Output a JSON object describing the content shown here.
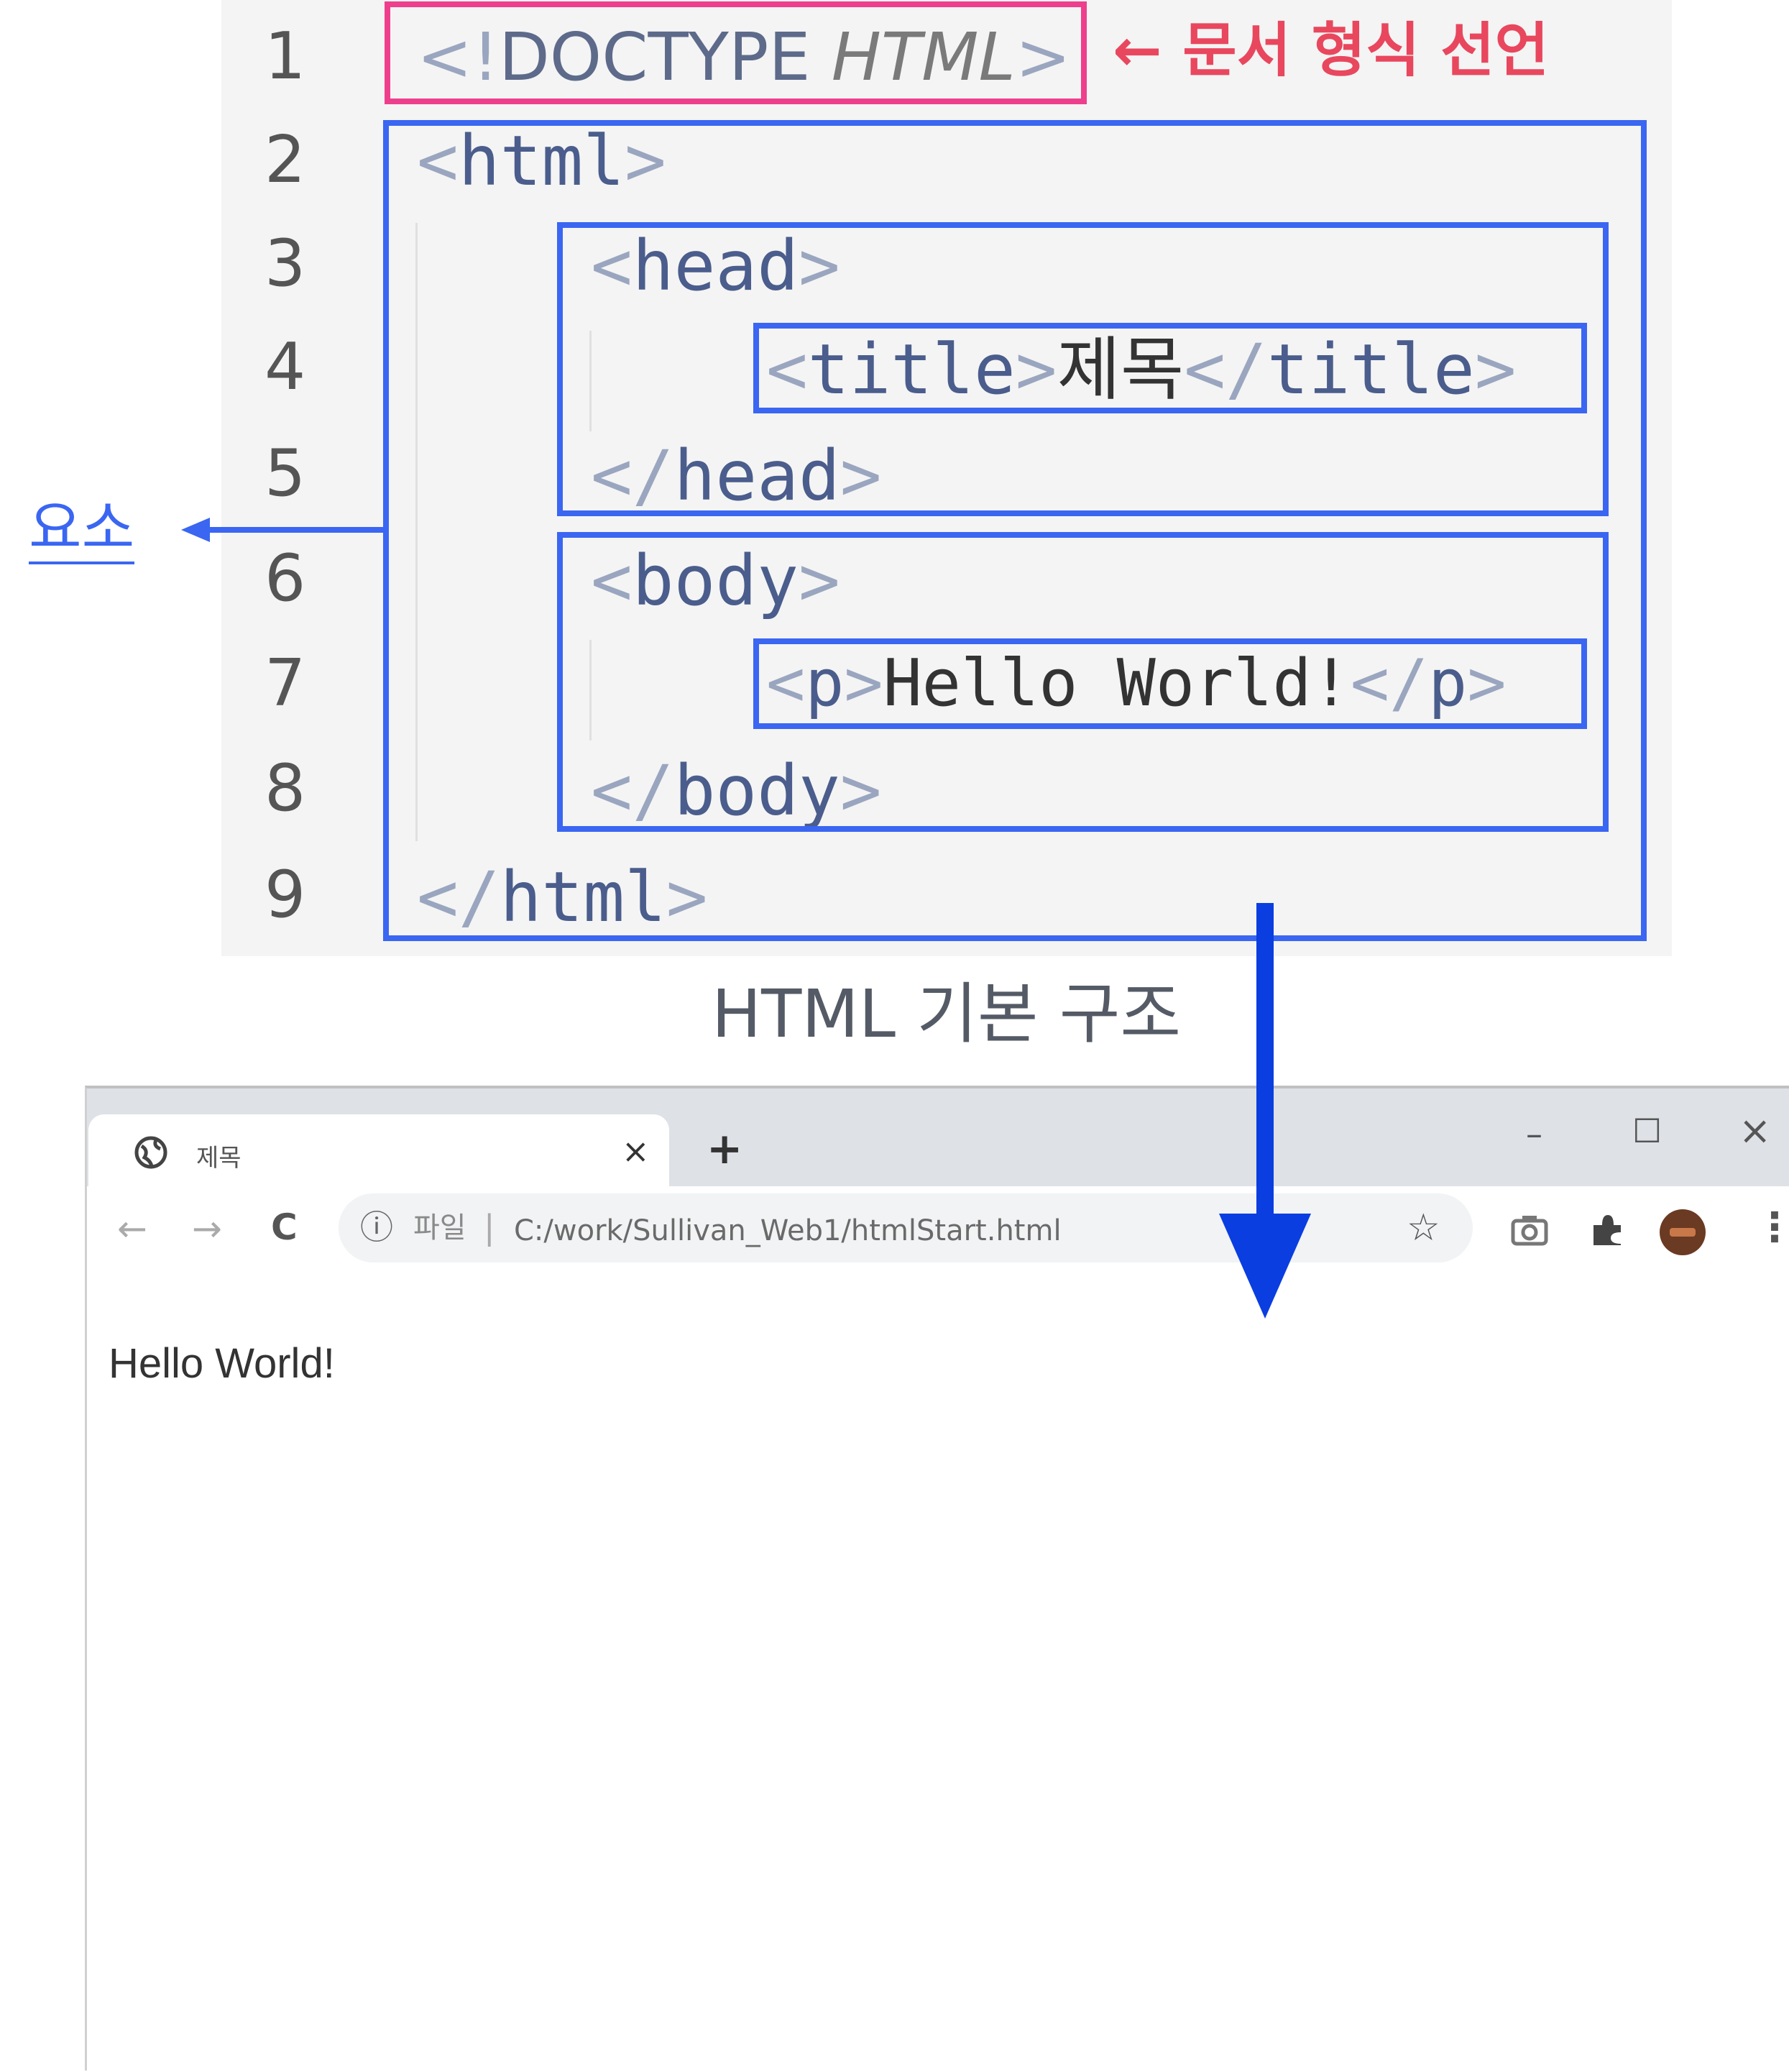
{
  "code": {
    "line_numbers": [
      "1",
      "2",
      "3",
      "4",
      "5",
      "6",
      "7",
      "8",
      "9"
    ],
    "doctype": {
      "open": "<!",
      "keyword": "DOCTYPE",
      "arg": "HTML",
      "close": ">"
    },
    "html_open": {
      "lt": "<",
      "name": "html",
      "gt": ">"
    },
    "head_open": {
      "lt": "<",
      "name": "head",
      "gt": ">"
    },
    "title_line": {
      "open_lt": "<",
      "open_name": "title",
      "open_gt": ">",
      "content": "제목",
      "close_lt": "</",
      "close_name": "title",
      "close_gt": ">"
    },
    "head_close": {
      "lt": "</",
      "name": "head",
      "gt": ">"
    },
    "body_open": {
      "lt": "<",
      "name": "body",
      "gt": ">"
    },
    "p_line": {
      "open_lt": "<",
      "open_name": "p",
      "open_gt": ">",
      "content": "Hello World!",
      "close_lt": "</",
      "close_name": "p",
      "close_gt": ">"
    },
    "body_close": {
      "lt": "</",
      "name": "body",
      "gt": ">"
    },
    "html_close": {
      "lt": "</",
      "name": "html",
      "gt": ">"
    }
  },
  "annotations": {
    "doctype_note": "← 문서 형식 선언",
    "element_label": "요소",
    "caption": "HTML 기본 구조"
  },
  "browser": {
    "tab_title": "제목",
    "tab_close": "×",
    "new_tab": "+",
    "win_minimize": "–",
    "win_maximize": "☐",
    "win_close": "×",
    "back": "←",
    "forward": "→",
    "reload": "C",
    "info_icon": "ⓘ",
    "url_scheme_label": "파일",
    "url_separator": "|",
    "url": "C:/work/Sullivan_Web1/htmlStart.html",
    "star": "☆",
    "menu": "⋮",
    "page_text": "Hello World!"
  },
  "colors": {
    "element_box": "#3a66f2",
    "doctype_box": "#ee3f8c",
    "doctype_note": "#e8475e",
    "arrow": "#0a3ee0"
  }
}
